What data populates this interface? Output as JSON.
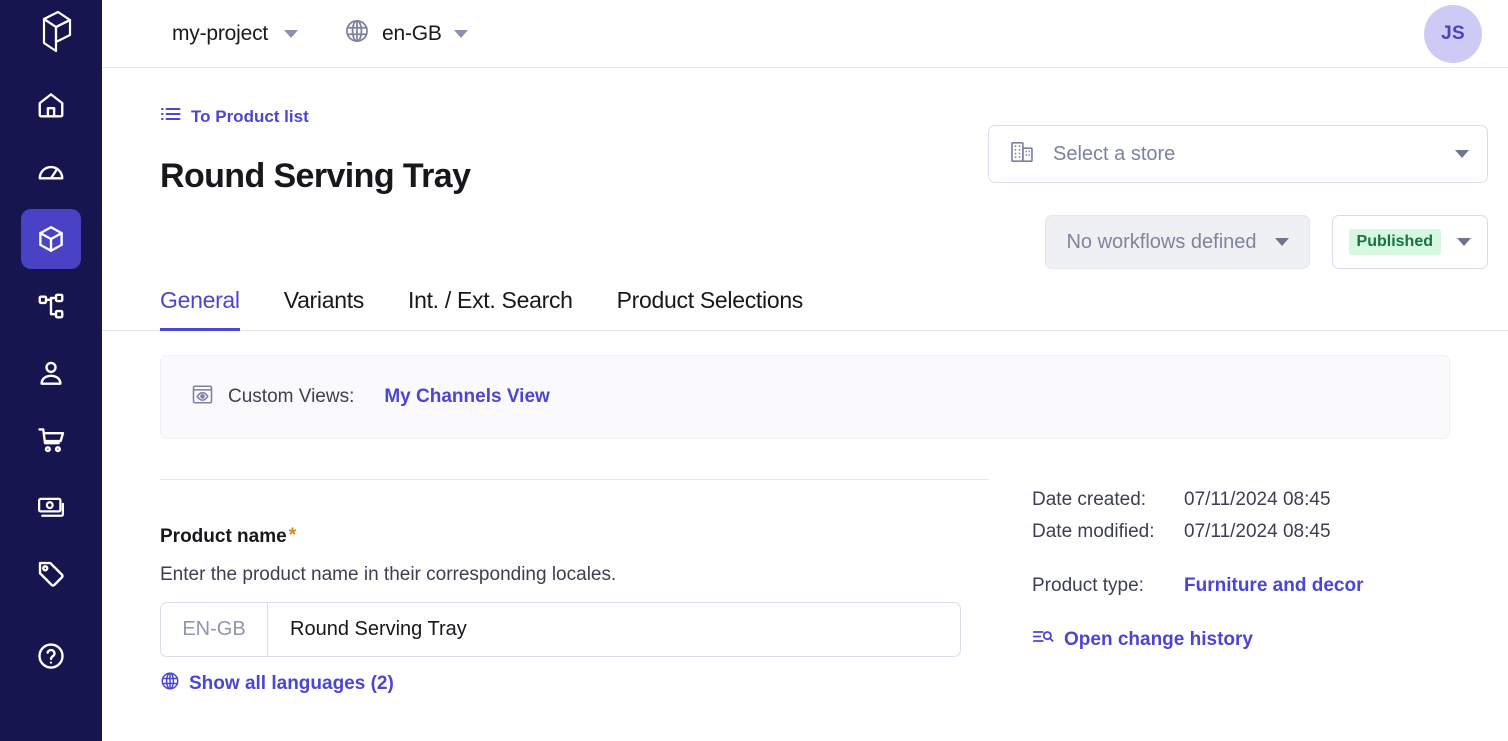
{
  "colors": {
    "sidebar_bg": "#17154f",
    "sidebar_active": "#4a42c4",
    "accent": "#4c45d4",
    "badge_bg": "#d6f8e0",
    "badge_text": "#157347",
    "required_star": "#d8860b",
    "avatar_bg": "#cdcbf5"
  },
  "sidebar": {
    "logo_icon": "cube-logo-icon",
    "items": [
      {
        "icon": "home-icon",
        "name": "home",
        "active": false
      },
      {
        "icon": "dashboard-icon",
        "name": "dashboard",
        "active": false
      },
      {
        "icon": "box-icon",
        "name": "products",
        "active": true
      },
      {
        "icon": "hierarchy-icon",
        "name": "categories",
        "active": false
      },
      {
        "icon": "user-icon",
        "name": "customers",
        "active": false
      },
      {
        "icon": "cart-icon",
        "name": "orders",
        "active": false
      },
      {
        "icon": "money-icon",
        "name": "payments",
        "active": false
      },
      {
        "icon": "tag-icon",
        "name": "discounts",
        "active": false
      },
      {
        "icon": "help-icon",
        "name": "help",
        "active": false
      }
    ]
  },
  "topbar": {
    "project": "my-project",
    "project_caret_icon": "chevron-down-icon",
    "locale_icon": "globe-icon",
    "locale": "en-GB",
    "locale_caret_icon": "chevron-down-icon",
    "avatar_initials": "JS"
  },
  "breadcrumb": {
    "icon": "list-icon",
    "label": "To Product list"
  },
  "header": {
    "title": "Round Serving Tray"
  },
  "store_select": {
    "icon": "store-building-icon",
    "placeholder": "Select a store",
    "caret_icon": "chevron-down-icon"
  },
  "workflow": {
    "label": "No workflows defined",
    "caret_icon": "chevron-down-icon"
  },
  "status": {
    "label": "Published",
    "caret_icon": "chevron-down-icon"
  },
  "tabs": [
    {
      "label": "General",
      "active": true
    },
    {
      "label": "Variants",
      "active": false
    },
    {
      "label": "Int. / Ext. Search",
      "active": false
    },
    {
      "label": "Product Selections",
      "active": false
    }
  ],
  "custom_views": {
    "icon": "eye-view-icon",
    "label": "Custom Views:",
    "link": "My Channels View"
  },
  "product_name_field": {
    "label": "Product name",
    "required_marker": "*",
    "help": "Enter the product name in their corresponding locales.",
    "locale": "EN-GB",
    "value": "Round Serving Tray",
    "show_languages_icon": "globe-icon",
    "show_languages": "Show all languages (2)"
  },
  "meta": {
    "rows": [
      {
        "key": "Date created:",
        "value": "07/11/2024 08:45"
      },
      {
        "key": "Date modified:",
        "value": "07/11/2024 08:45"
      }
    ],
    "product_type_key": "Product type:",
    "product_type_value": "Furniture and decor",
    "history_icon": "change-history-icon",
    "history_label": "Open change history"
  }
}
